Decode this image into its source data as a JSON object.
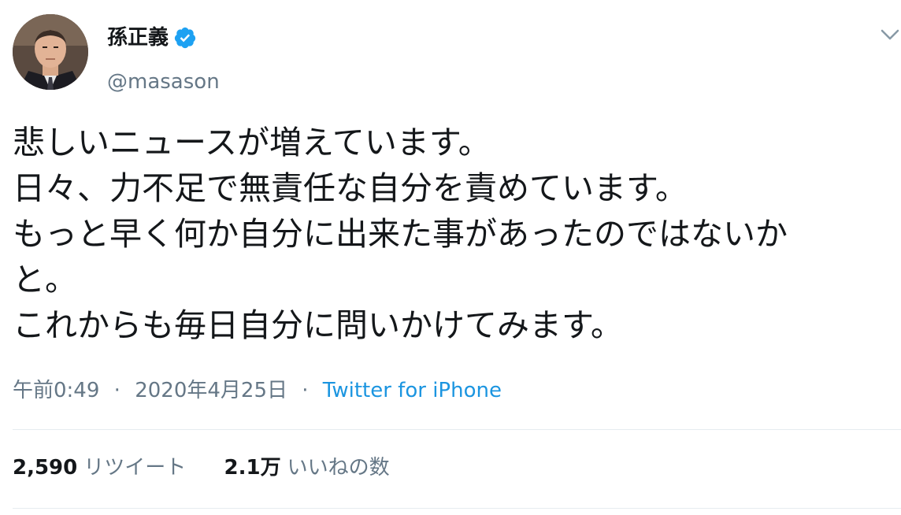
{
  "user": {
    "display_name": "孫正義",
    "handle": "@masason",
    "verified_icon": "verified-badge-icon",
    "avatar_icon": "avatar-photo"
  },
  "tweet": {
    "lines": [
      "悲しいニュースが増えています。",
      "日々、力不足で無責任な自分を責めています。",
      "もっと早く何か自分に出来た事があったのではないか",
      "と。",
      "これからも毎日自分に問いかけてみます。"
    ],
    "time": "午前0:49",
    "separator": "·",
    "date": "2020年4月25日",
    "source": "Twitter for iPhone"
  },
  "stats": {
    "retweets_count": "2,590",
    "retweets_label": "リツイート",
    "likes_count": "2.1万",
    "likes_label": "いいねの数"
  },
  "colors": {
    "text": "#14171a",
    "muted": "#657786",
    "link": "#1b95e0",
    "verified": "#1da1f2",
    "divider": "#e6ecf0"
  },
  "icons": {
    "caret": "chevron-down-icon"
  }
}
